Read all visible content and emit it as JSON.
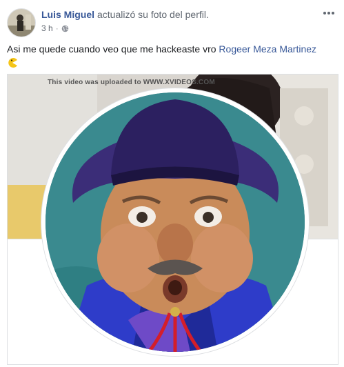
{
  "post": {
    "author": "Luis Miguel",
    "action": "actualizó su foto del perfil.",
    "time": "3 h",
    "separator": "·",
    "audience_icon": "globe-icon",
    "more_icon": "more-options-icon"
  },
  "caption": {
    "text": "Asi me quede cuando veo que me hackeaste vro",
    "mention": "Rogeer Meza Martinez",
    "emoji": "pacman-face-emoji"
  },
  "media": {
    "watermark": "This video was uploaded to WWW.XVIDEOS.COM"
  },
  "colors": {
    "link": "#385898",
    "meta": "#606770",
    "hat": "#3b2d78",
    "shirt": "#2e3cc9",
    "bandana": "#d41e2a"
  }
}
